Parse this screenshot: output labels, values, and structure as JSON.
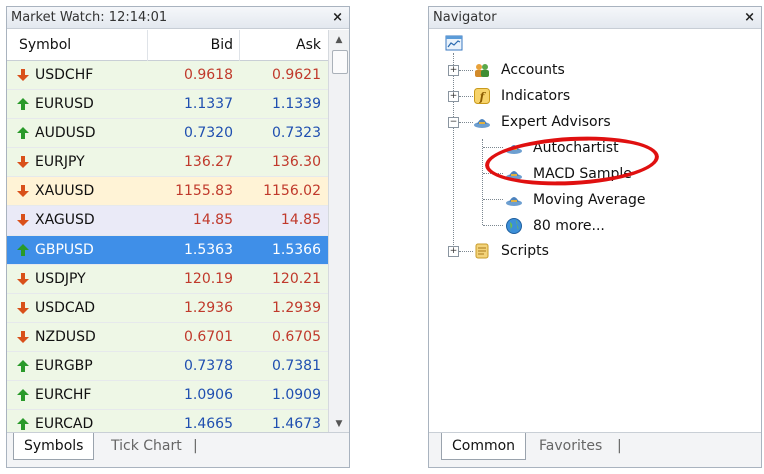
{
  "market_watch": {
    "title": "Market Watch: 12:14:01",
    "close": "×",
    "columns": {
      "symbol": "Symbol",
      "bid": "Bid",
      "ask": "Ask"
    },
    "rows": [
      {
        "symbol": "USDCHF",
        "bid": "0.9618",
        "ask": "0.9621",
        "dir": "down"
      },
      {
        "symbol": "EURUSD",
        "bid": "1.1337",
        "ask": "1.1339",
        "dir": "up"
      },
      {
        "symbol": "AUDUSD",
        "bid": "0.7320",
        "ask": "0.7323",
        "dir": "up"
      },
      {
        "symbol": "EURJPY",
        "bid": "136.27",
        "ask": "136.30",
        "dir": "down"
      },
      {
        "symbol": "XAUUSD",
        "bid": "1155.83",
        "ask": "1156.02",
        "dir": "down"
      },
      {
        "symbol": "XAGUSD",
        "bid": "14.85",
        "ask": "14.85",
        "dir": "down"
      },
      {
        "symbol": "GBPUSD",
        "bid": "1.5363",
        "ask": "1.5366",
        "dir": "up"
      },
      {
        "symbol": "USDJPY",
        "bid": "120.19",
        "ask": "120.21",
        "dir": "down"
      },
      {
        "symbol": "USDCAD",
        "bid": "1.2936",
        "ask": "1.2939",
        "dir": "down"
      },
      {
        "symbol": "NZDUSD",
        "bid": "0.6701",
        "ask": "0.6705",
        "dir": "down"
      },
      {
        "symbol": "EURGBP",
        "bid": "0.7378",
        "ask": "0.7381",
        "dir": "up"
      },
      {
        "symbol": "EURCHF",
        "bid": "1.0906",
        "ask": "1.0909",
        "dir": "up"
      },
      {
        "symbol": "EURCAD",
        "bid": "1.4665",
        "ask": "1.4673",
        "dir": "up"
      }
    ],
    "tabs": {
      "symbols": "Symbols",
      "tick_chart": "Tick Chart",
      "sep": "|"
    }
  },
  "navigator": {
    "title": "Navigator",
    "close": "×",
    "items": {
      "accounts": "Accounts",
      "indicators": "Indicators",
      "expert_advisors": "Expert Advisors",
      "autochartist": "Autochartist",
      "macd_sample": "MACD Sample",
      "moving_average": "Moving Average",
      "more": "80 more...",
      "scripts": "Scripts"
    },
    "tabs": {
      "common": "Common",
      "favorites": "Favorites",
      "sep": "|"
    }
  },
  "colors": {
    "up": "#2a9a2a",
    "down": "#d9501a",
    "down_price": "#c0392b",
    "up_price": "#1f4fb0",
    "selection": "#3f8fe8",
    "highlight_circle": "#e01010"
  }
}
